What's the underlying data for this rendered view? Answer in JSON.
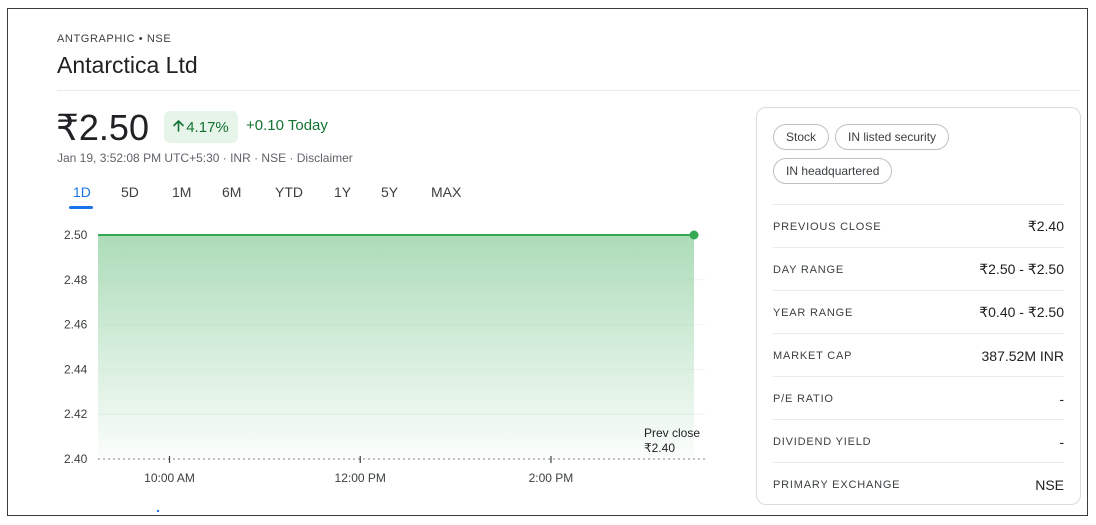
{
  "header": {
    "ticker_line": "ANTGRAPHIC • NSE",
    "company_name": "Antarctica Ltd"
  },
  "quote": {
    "price": "₹2.50",
    "change_percent": "4.17%",
    "change_arrow_icon": "arrow-up-icon",
    "change_today": "+0.10 Today",
    "meta_text": "Jan 19, 3:52:08 PM UTC+5:30 · INR · NSE · ",
    "disclaimer": "Disclaimer",
    "positive_color": "#137333"
  },
  "range_tabs": [
    {
      "label": "1D",
      "active": true
    },
    {
      "label": "5D",
      "active": false
    },
    {
      "label": "1M",
      "active": false
    },
    {
      "label": "6M",
      "active": false
    },
    {
      "label": "YTD",
      "active": false
    },
    {
      "label": "1Y",
      "active": false
    },
    {
      "label": "5Y",
      "active": false
    },
    {
      "label": "MAX",
      "active": false
    }
  ],
  "chart_data": {
    "type": "area",
    "y_ticks": [
      "2.50",
      "2.48",
      "2.46",
      "2.44",
      "2.42",
      "2.40"
    ],
    "ylim": [
      2.4,
      2.5
    ],
    "x_ticks": [
      "10:00 AM",
      "12:00 PM",
      "2:00 PM"
    ],
    "series": [
      {
        "x": [
          "09:15",
          "15:30"
        ],
        "values": [
          2.5,
          2.5
        ]
      }
    ],
    "prev_close_label": "Prev close",
    "prev_close_value": "₹2.40",
    "prev_close": 2.4,
    "line_color": "#34a853",
    "fill_color": "#a8dab5",
    "grid": true
  },
  "sidebar": {
    "chips": [
      "Stock",
      "IN listed security",
      "IN headquartered"
    ],
    "stats": [
      {
        "label": "PREVIOUS CLOSE",
        "value": "₹2.40"
      },
      {
        "label": "DAY RANGE",
        "value": "₹2.50 - ₹2.50"
      },
      {
        "label": "YEAR RANGE",
        "value": "₹0.40 - ₹2.50"
      },
      {
        "label": "MARKET CAP",
        "value": "387.52M INR"
      },
      {
        "label": "P/E RATIO",
        "value": "-"
      },
      {
        "label": "DIVIDEND YIELD",
        "value": "-"
      },
      {
        "label": "PRIMARY EXCHANGE",
        "value": "NSE"
      }
    ]
  }
}
